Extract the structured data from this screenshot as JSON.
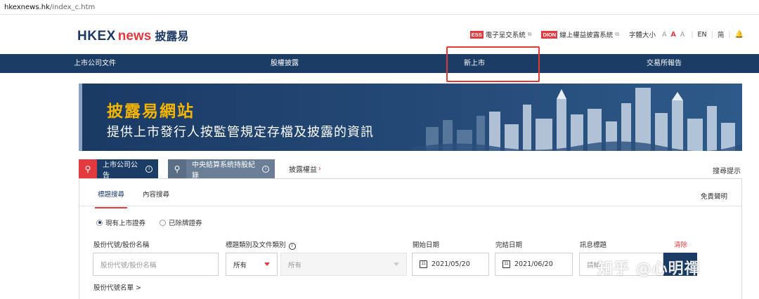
{
  "browser": {
    "url_host": "hkexnews.hk",
    "url_path": "/index_c.htm"
  },
  "header": {
    "logo_hkex": "HKEX",
    "logo_news": "news",
    "logo_cn": "披露易",
    "links": {
      "ess_badge": "ESS",
      "ess_label": "電子呈交系統",
      "dion_badge": "DION",
      "dion_label": "線上權益披露系統",
      "font_size_label": "字體大小",
      "font_a": "A",
      "en": "EN",
      "simplified": "简"
    }
  },
  "nav": {
    "items": [
      "上市公司文件",
      "股權披露",
      "新上市",
      "交易所報告"
    ]
  },
  "banner": {
    "title": "披露易網站",
    "subtitle": "提供上市發行人按監管規定存檔及披露的資訊"
  },
  "search_tabs": {
    "tab1": "上市公司公告",
    "tab2": "中央結算系統持股紀錄",
    "tab3": "披露權益",
    "tips": "搜尋提示",
    "info": "i"
  },
  "panel": {
    "subtabs": [
      "標題搜尋",
      "內容搜尋"
    ],
    "disclaimer": "免責聲明",
    "radios": [
      "現有上市證券",
      "已除牌證券"
    ],
    "labels": {
      "stock": "股份代號/股份名稱",
      "category": "標題類別及文件類別",
      "start": "開始日期",
      "end": "完結日期",
      "headline": "訊息標題",
      "clear": "清除"
    },
    "fields": {
      "stock_placeholder": "股份代號/股份名稱",
      "category_value": "所有",
      "doc_type_value": "所有",
      "start_date": "2021/05/20",
      "end_date": "2021/06/20",
      "headline_placeholder": "請輸"
    },
    "stock_list_link": "股份代號名單 >"
  },
  "watermark": "知乎 @心明禪"
}
